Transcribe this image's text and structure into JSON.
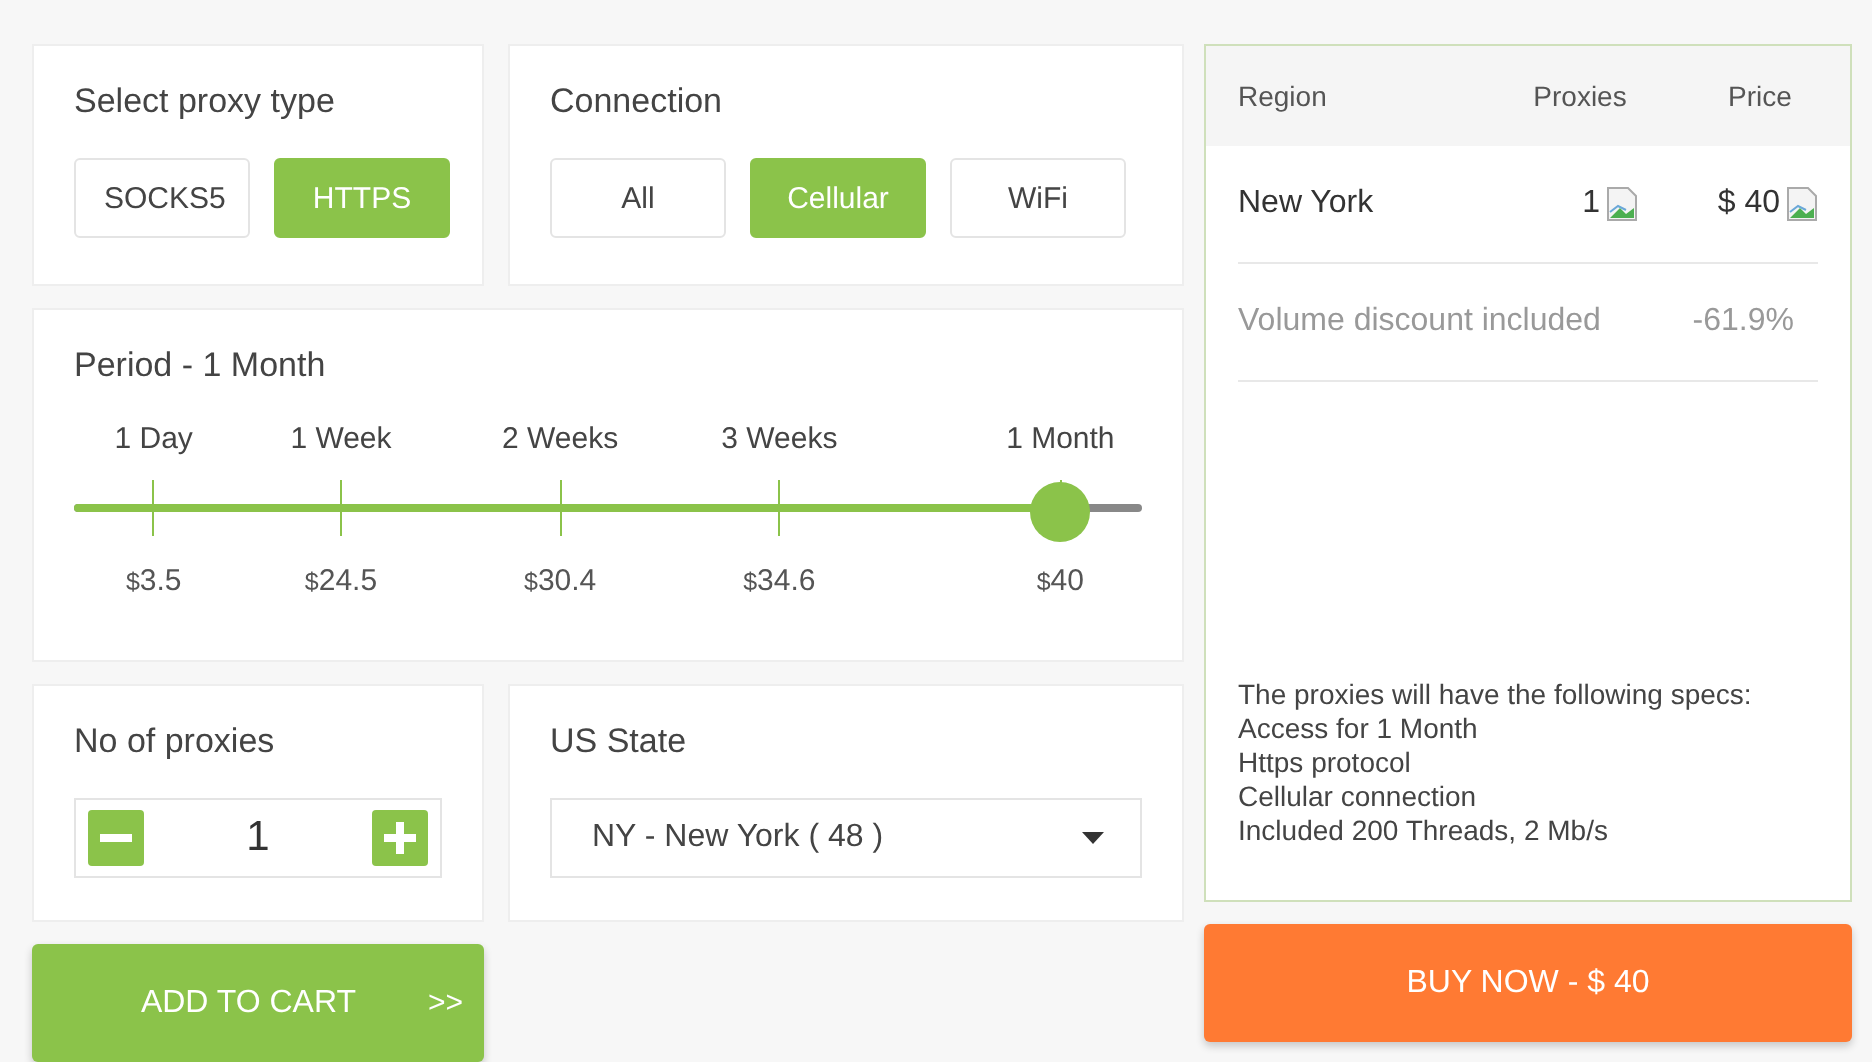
{
  "proxy_type": {
    "title": "Select proxy type",
    "options": [
      {
        "label": "SOCKS5",
        "selected": false
      },
      {
        "label": "HTTPS",
        "selected": true
      }
    ]
  },
  "connection": {
    "title": "Connection",
    "options": [
      {
        "label": "All",
        "selected": false
      },
      {
        "label": "Cellular",
        "selected": true
      },
      {
        "label": "WiFi",
        "selected": false
      }
    ]
  },
  "period": {
    "title": "Period - 1 Month",
    "level": 0.923,
    "stops": [
      {
        "label": "1 Day",
        "currency": "$",
        "price": "3.5"
      },
      {
        "label": "1 Week",
        "currency": "$",
        "price": "24.5"
      },
      {
        "label": "2 Weeks",
        "currency": "$",
        "price": "30.4"
      },
      {
        "label": "3 Weeks",
        "currency": "$",
        "price": "34.6"
      },
      {
        "label": "1 Month",
        "currency": "$",
        "price": "40"
      }
    ]
  },
  "quantity": {
    "title": "No of proxies",
    "value": "1"
  },
  "state": {
    "title": "US State",
    "value": "NY - New York ( 48 )"
  },
  "add_to_cart": {
    "label": "ADD TO CART",
    "arrow": ">>"
  },
  "summary": {
    "columns": [
      "Region",
      "Proxies",
      "Price"
    ],
    "rows": [
      {
        "region": "New York",
        "proxies": "1",
        "price": "$ 40"
      }
    ],
    "discount": {
      "label": "Volume discount included",
      "value": "-61.9%"
    },
    "specs": [
      "The proxies will have the following specs:",
      "Access for 1 Month",
      "Https protocol",
      "Cellular connection",
      "Included 200 Threads, 2 Mb/s"
    ]
  },
  "buy_now": {
    "label": "BUY NOW - $ 40"
  }
}
